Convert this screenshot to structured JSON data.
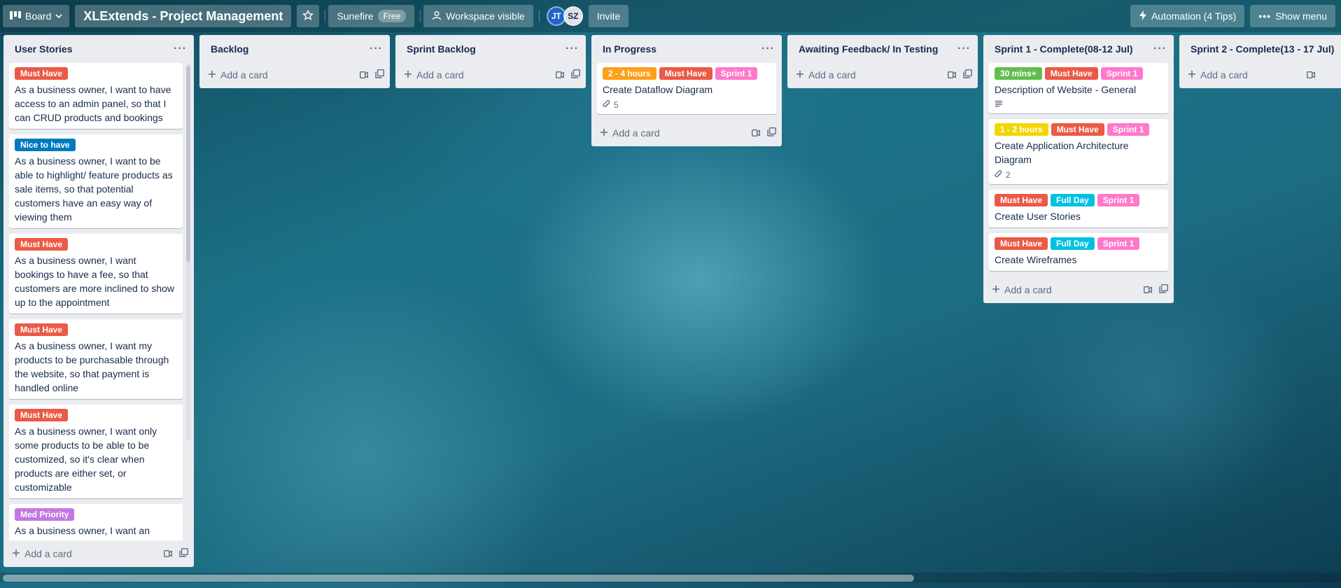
{
  "topbar": {
    "board_label": "Board",
    "title": "XLExtends - Project Management",
    "workspace_name": "Sunefire",
    "plan_badge": "Free",
    "visibility": "Workspace visible",
    "members": [
      "JT",
      "SZ"
    ],
    "invite_label": "Invite",
    "automation_label": "Automation (4 Tips)",
    "menu_label": "Show menu"
  },
  "labels": {
    "must_have": {
      "text": "Must Have",
      "color": "#eb5a46"
    },
    "nice_to_have": {
      "text": "Nice to have",
      "color": "#0079bf"
    },
    "med_priority": {
      "text": "Med Priority",
      "color": "#c377e0"
    },
    "sprint1": {
      "text": "Sprint 1",
      "color": "#ff78cb"
    },
    "t_2_4": {
      "text": "2 - 4 hours",
      "color": "#ff9f1a"
    },
    "t_30": {
      "text": "30 mins+",
      "color": "#61bd4f"
    },
    "t_1_2": {
      "text": "1 - 2 hours",
      "color": "#f2d600"
    },
    "full_day": {
      "text": "Full Day",
      "color": "#00c2e0"
    }
  },
  "add_card_label": "Add a card",
  "lists": {
    "user_stories": {
      "title": "User Stories",
      "cards": [
        {
          "label": "Must Have",
          "text": "As a business owner, I want to have access to an admin panel, so that I can CRUD products and bookings"
        },
        {
          "label": "Nice to have",
          "text": "As a business owner, I want to be able to highlight/ feature products as sale items, so that potential customers have an easy way of viewing them"
        },
        {
          "label": "Must Have",
          "text": "As a business owner, I want bookings to have a fee, so that customers are more inclined to show up to the appointment"
        },
        {
          "label": "Must Have",
          "text": "As a business owner, I want my products to be purchasable through the website, so that payment is handled online"
        },
        {
          "label": "Must Have",
          "text": "As a business owner, I want only some products to be able to be customized, so it's clear when products are either set, or customizable"
        },
        {
          "label": "Med Priority",
          "text": "As a business owner, I want an available pickup location displayed,"
        }
      ]
    },
    "backlog": {
      "title": "Backlog"
    },
    "sprint_backlog": {
      "title": "Sprint Backlog"
    },
    "in_progress": {
      "title": "In Progress",
      "cards": [
        {
          "labels": [
            "2 - 4 hours",
            "Must Have",
            "Sprint 1"
          ],
          "text": "Create Dataflow Diagram",
          "attachments": "5"
        }
      ]
    },
    "awaiting": {
      "title": "Awaiting Feedback/ In Testing"
    },
    "sprint1_complete": {
      "title": "Sprint 1 - Complete(08-12 Jul)",
      "cards": [
        {
          "labels": [
            "30 mins+",
            "Must Have",
            "Sprint 1"
          ],
          "text": "Description of Website - General"
        },
        {
          "labels": [
            "1 - 2 hours",
            "Must Have",
            "Sprint 1"
          ],
          "text": "Create Application Architecture Diagram",
          "attachments": "2"
        },
        {
          "labels": [
            "Must Have",
            "Full Day",
            "Sprint 1"
          ],
          "text": "Create User Stories"
        },
        {
          "labels": [
            "Must Have",
            "Full Day",
            "Sprint 1"
          ],
          "text": "Create Wireframes"
        }
      ]
    },
    "sprint2_complete": {
      "title": "Sprint 2 - Complete(13 - 17 Jul)"
    }
  }
}
